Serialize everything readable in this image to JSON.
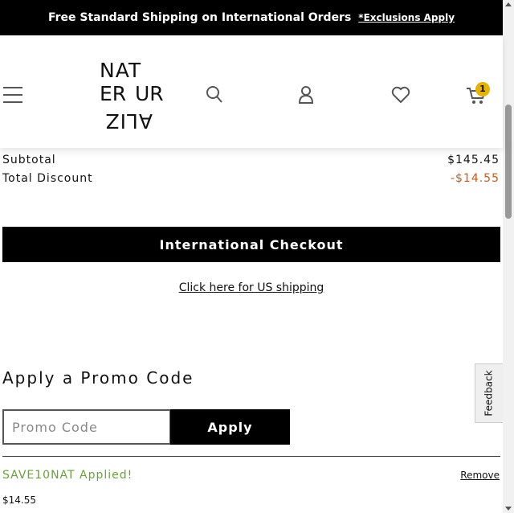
{
  "banner": {
    "message": "Free Standard Shipping on International Orders",
    "exclusions_link": "*Exclusions Apply"
  },
  "header": {
    "logo": {
      "row_top": "NAT",
      "col_left": "ER",
      "col_right": "UR",
      "row_bottom": "ALIZ"
    },
    "cart_count": "1",
    "icons": [
      "menu-icon",
      "search-icon",
      "account-icon",
      "wishlist-icon",
      "cart-icon"
    ]
  },
  "summary": {
    "subtotal_label": "Subtotal",
    "subtotal_value": "$145.45",
    "discount_label": "Total Discount",
    "discount_value": "-$14.55"
  },
  "checkout": {
    "button_label": "International Checkout",
    "us_shipping_link": "Click here for US shipping"
  },
  "promo": {
    "title": "Apply a Promo Code",
    "input_placeholder": "Promo Code",
    "input_value": "",
    "apply_label": "Apply",
    "applied_message": "SAVE10NAT Applied!",
    "remove_label": "Remove",
    "discount_amount": "$14.55"
  },
  "feedback_tab": "Feedback",
  "colors": {
    "discount": "#c45a1c",
    "applied": "#6aa13a",
    "badge": "#e6b400"
  }
}
